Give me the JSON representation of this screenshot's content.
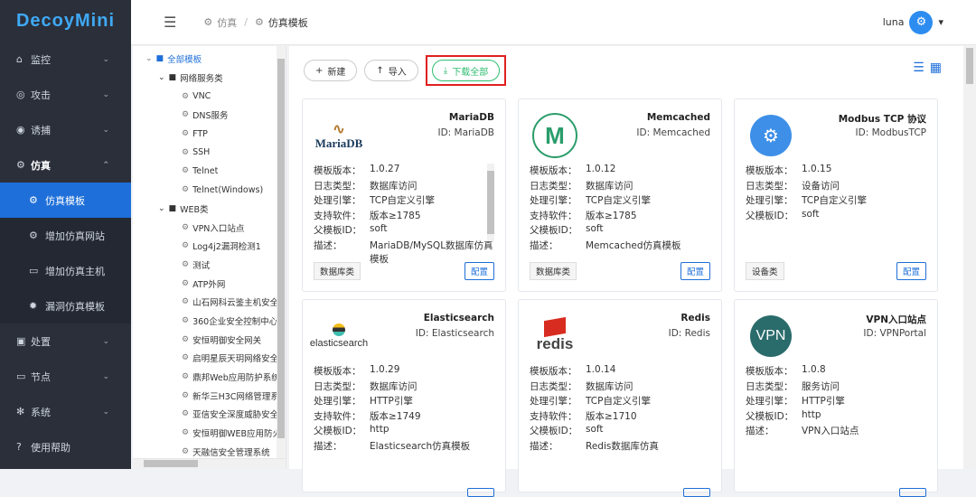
{
  "app": {
    "logo": "DecoyMini"
  },
  "sidebar": {
    "items": [
      {
        "label": "监控",
        "icon": "home-icon",
        "glyph": "⌂",
        "chev": "⌄"
      },
      {
        "label": "攻击",
        "icon": "target-icon",
        "glyph": "◎",
        "chev": "⌄"
      },
      {
        "label": "诱捕",
        "icon": "trap-icon",
        "glyph": "◉",
        "chev": "⌄"
      },
      {
        "label": "仿真",
        "icon": "gear-icon",
        "glyph": "⚙",
        "chev": "⌃"
      },
      {
        "label": "处置",
        "icon": "briefcase-icon",
        "glyph": "▣",
        "chev": "⌄"
      },
      {
        "label": "节点",
        "icon": "monitor-icon",
        "glyph": "▭",
        "chev": "⌄"
      },
      {
        "label": "系统",
        "icon": "settings-icon",
        "glyph": "✻",
        "chev": "⌄"
      },
      {
        "label": "使用帮助",
        "icon": "help-icon",
        "glyph": "?"
      }
    ],
    "subitems": [
      {
        "label": "仿真模板",
        "glyph": "⚙"
      },
      {
        "label": "增加仿真网站",
        "glyph": "⚙"
      },
      {
        "label": "增加仿真主机",
        "glyph": "▭"
      },
      {
        "label": "漏洞仿真模板",
        "glyph": "✹"
      }
    ]
  },
  "header": {
    "menu_glyph": "☰",
    "breadcrumb": [
      "仿真",
      "仿真模板"
    ],
    "crumb_glyph": "⚙",
    "sep": "/",
    "user": "luna",
    "caret": "▾",
    "avatar_glyph": "⚙"
  },
  "tree": {
    "root": "全部模板",
    "groups": [
      {
        "label": "网络服务类",
        "items": [
          "VNC",
          "DNS服务",
          "FTP",
          "SSH",
          "Telnet",
          "Telnet(Windows)"
        ]
      },
      {
        "label": "WEB类",
        "items": [
          "VPN入口站点",
          "Log4j2漏洞检测1",
          "测试",
          "ATP外网",
          "山石网科云鉴主机安全",
          "360企业安全控制中心",
          "安恒明御安全网关",
          "启明星辰天玥网络安全",
          "鼎邦Web应用防护系统",
          "新华三H3C网络管理系统",
          "亚信安全深度威胁安全",
          "安恒明御WEB应用防火",
          "天融信安全管理系统"
        ]
      }
    ],
    "expander": "⌄",
    "folder_glyph": "■",
    "leaf_glyph": "⚙"
  },
  "toolbar": {
    "new_label": "新建",
    "new_glyph": "+",
    "import_label": "导入",
    "import_glyph": "↑",
    "download_label": "下载全部",
    "download_glyph": "⤓",
    "list_view_glyph": "☰",
    "grid_view_glyph": "▦"
  },
  "card_labels": {
    "version": "模板版本：",
    "log_type": "日志类型：",
    "engine": "处理引擎：",
    "software": "支持软件：",
    "parent": "父模板ID：",
    "desc": "描述：",
    "config": "配置"
  },
  "cards": [
    {
      "name": "MariaDB",
      "id": "ID: MariaDB",
      "logo": "MariaDB",
      "version": "1.0.27",
      "log_type": "数据库访问",
      "engine": "TCP自定义引擎",
      "software": "版本≥1785",
      "parent": "soft",
      "desc": "MariaDB/MySQL数据库仿真模板",
      "tag": "数据库类"
    },
    {
      "name": "Memcached",
      "id": "ID: Memcached",
      "logo": "M",
      "version": "1.0.12",
      "log_type": "数据库访问",
      "engine": "TCP自定义引擎",
      "software": "版本≥1785",
      "parent": "soft",
      "desc": "Memcached仿真模板",
      "tag": "数据库类"
    },
    {
      "name": "Modbus TCP 协议",
      "id": "ID: ModbusTCP",
      "logo": "⚙",
      "version": "1.0.15",
      "log_type": "设备访问",
      "engine": "TCP自定义引擎",
      "parent": "soft",
      "tag": "设备类"
    },
    {
      "name": "Elasticsearch",
      "id": "ID: Elasticsearch",
      "logo": "elasticsearch",
      "version": "1.0.29",
      "log_type": "数据库访问",
      "engine": "HTTP引擎",
      "software": "版本≥1749",
      "parent": "http",
      "desc": "Elasticsearch仿真模板"
    },
    {
      "name": "Redis",
      "id": "ID: Redis",
      "logo": "redis",
      "version": "1.0.14",
      "log_type": "数据库访问",
      "engine": "TCP自定义引擎",
      "software": "版本≥1710",
      "parent": "soft",
      "desc": "Redis数据库仿真"
    },
    {
      "name": "VPN入口站点",
      "id": "ID: VPNPortal",
      "logo": "VPN",
      "version": "1.0.8",
      "log_type": "服务访问",
      "engine": "HTTP引擎",
      "parent": "http",
      "desc": "VPN入口站点"
    }
  ]
}
